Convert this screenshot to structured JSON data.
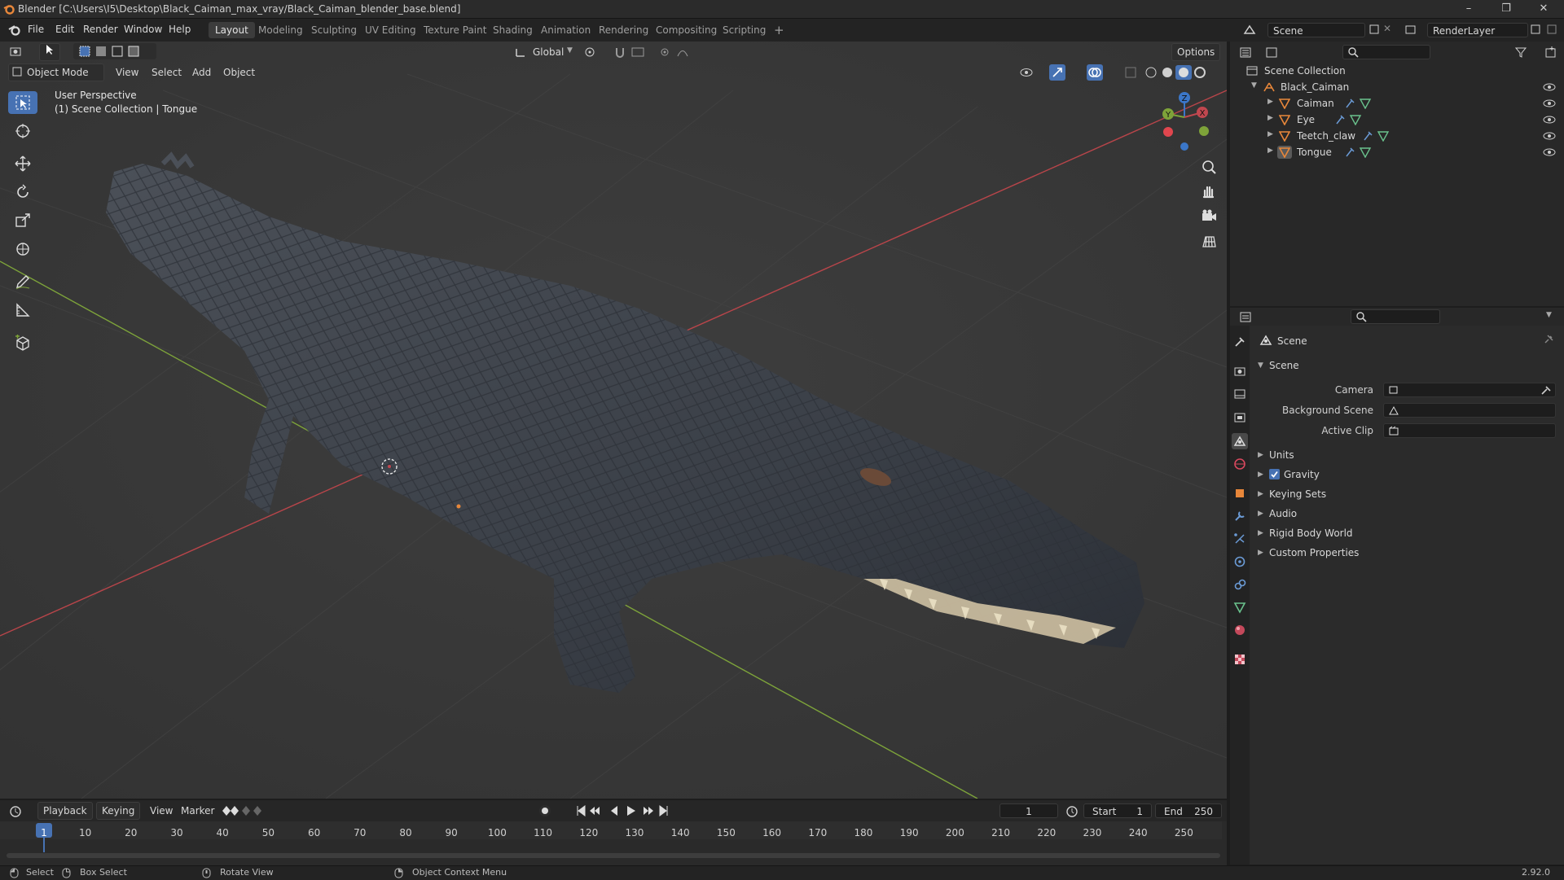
{
  "window": {
    "title": "Blender [C:\\Users\\I5\\Desktop\\Black_Caiman_max_vray/Black_Caiman_blender_base.blend]",
    "minimize": "–",
    "maximize": "❐",
    "close": "✕"
  },
  "menu": {
    "file": "File",
    "edit": "Edit",
    "render": "Render",
    "window": "Window",
    "help": "Help"
  },
  "workspaces": [
    "Layout",
    "Modeling",
    "Sculpting",
    "UV Editing",
    "Texture Paint",
    "Shading",
    "Animation",
    "Rendering",
    "Compositing",
    "Scripting"
  ],
  "add_workspace": "+",
  "scene_selector": {
    "value": "Scene"
  },
  "view_layer": {
    "value": "RenderLayer"
  },
  "viewport": {
    "orientation": "Global",
    "options": "Options",
    "mode": "Object Mode",
    "menus": {
      "view": "View",
      "select": "Select",
      "add": "Add",
      "object": "Object"
    },
    "overlay_line1": "User Perspective",
    "overlay_line2": "(1) Scene Collection | Tongue",
    "gizmo": {
      "x": "X",
      "y": "Y",
      "z": "Z"
    }
  },
  "outliner": {
    "root": "Scene Collection",
    "collection": "Black_Caiman",
    "objects": [
      "Caiman",
      "Eye",
      "Teetch_claw",
      "Tongue"
    ]
  },
  "properties": {
    "header": "Scene",
    "panel_scene": "Scene",
    "camera_label": "Camera",
    "background_scene_label": "Background Scene",
    "active_clip_label": "Active Clip",
    "panels": [
      "Units",
      "Gravity",
      "Keying Sets",
      "Audio",
      "Rigid Body World",
      "Custom Properties"
    ],
    "gravity_enabled": true
  },
  "timeline": {
    "playback": "Playback",
    "keying": "Keying",
    "view": "View",
    "marker": "Marker",
    "current_frame": "1",
    "start_label": "Start",
    "start_value": "1",
    "end_label": "End",
    "end_value": "250",
    "ruler": [
      "1",
      "10",
      "20",
      "30",
      "40",
      "50",
      "60",
      "70",
      "80",
      "90",
      "100",
      "110",
      "120",
      "130",
      "140",
      "150",
      "160",
      "170",
      "180",
      "190",
      "200",
      "210",
      "220",
      "230",
      "240",
      "250"
    ]
  },
  "status": {
    "select": "Select",
    "box_select": "Box Select",
    "rotate_view": "Rotate View",
    "context_menu": "Object Context Menu",
    "version": "2.92.0"
  },
  "colors": {
    "accent": "#4772b3",
    "x_axis": "#c0474f",
    "y_axis": "#7ea339",
    "z_axis": "#3b77c9",
    "object_orange": "#e8873a"
  }
}
